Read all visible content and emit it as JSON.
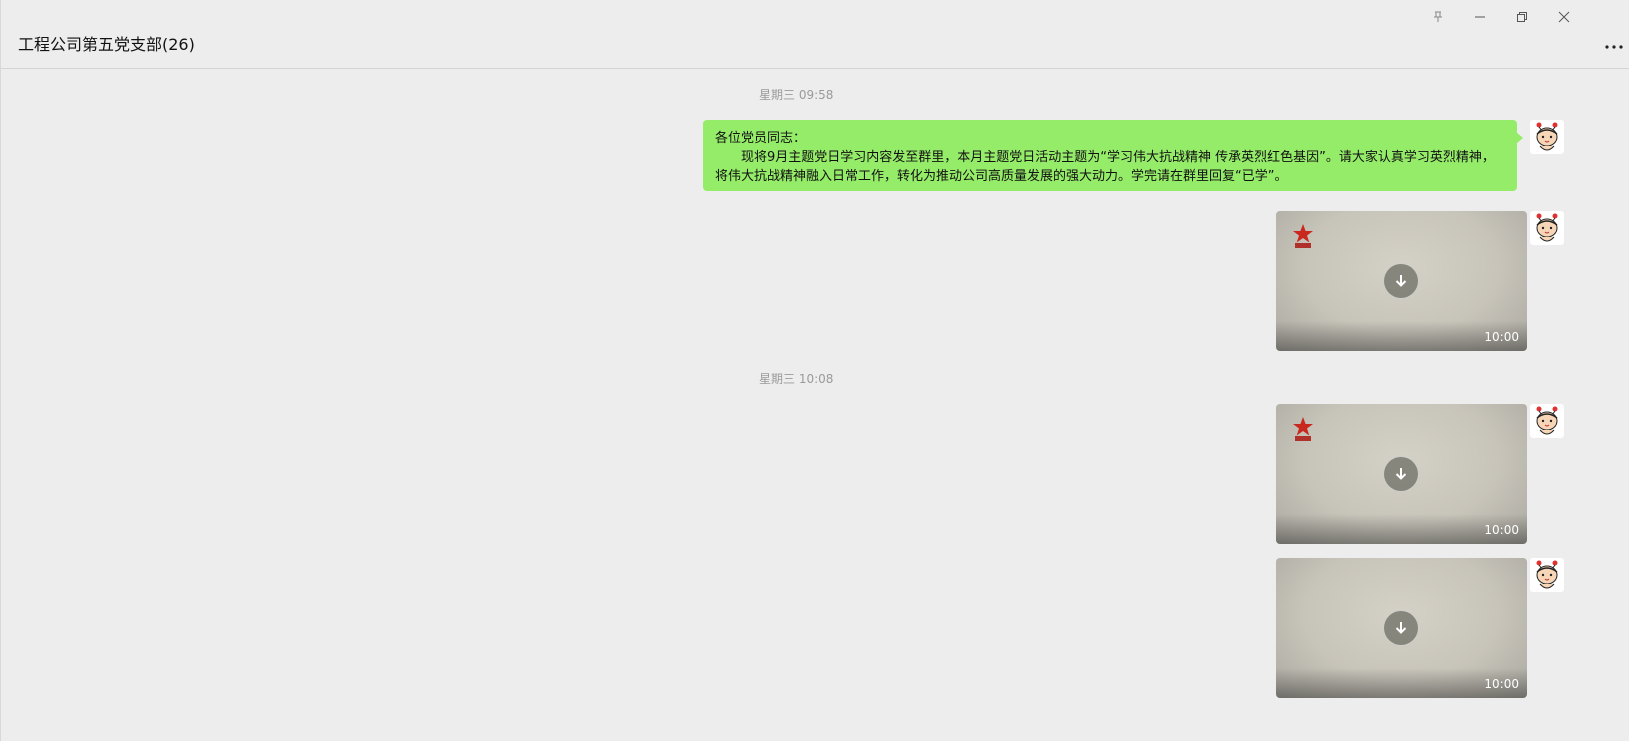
{
  "window": {
    "title": "工程公司第五党支部(26)",
    "controls": [
      "pin-icon",
      "minimize-icon",
      "restore-icon",
      "close-icon"
    ],
    "more_icon": "more-icon"
  },
  "messages": [
    {
      "type": "timestamp",
      "text": "星期三 09:58"
    },
    {
      "type": "text",
      "lines": [
        "各位党员同志：",
        "现将9月主题党日学习内容发至群里，本月主题党日活动主题为“学习伟大抗战精神 传承英烈红色基因”。请大家认真学习英烈精神，将伟大抗战精神融入日常工作，转化为推动公司高质量发展的强大动力。学完请在群里回复“已学”。"
      ]
    },
    {
      "type": "video",
      "duration": "10:00",
      "logo": true
    },
    {
      "type": "timestamp",
      "text": "星期三 10:08"
    },
    {
      "type": "video",
      "duration": "10:00",
      "logo": true
    },
    {
      "type": "video",
      "duration": "10:00",
      "logo": false
    }
  ],
  "colors": {
    "bubble": "#95ec69",
    "background": "#ededed"
  }
}
